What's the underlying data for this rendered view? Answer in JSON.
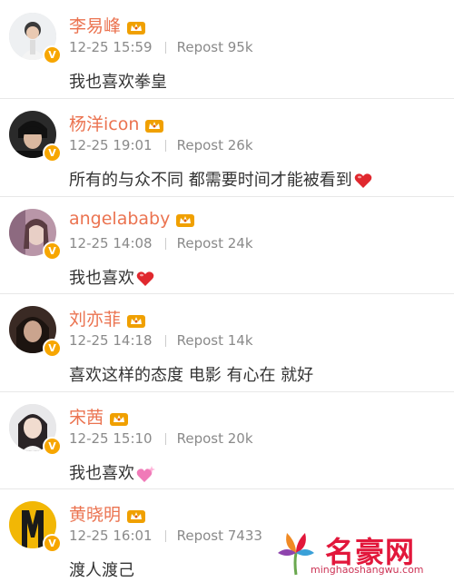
{
  "posts": [
    {
      "name": "李易峰",
      "date": "12-25 15:59",
      "repost": "Repost 95k",
      "text": "我也喜欢拳皇",
      "emoji": "none"
    },
    {
      "name": "杨洋icon",
      "date": "12-25 19:01",
      "repost": "Repost 26k",
      "text": "所有的与众不同 都需要时间才能被看到",
      "emoji": "red-heart"
    },
    {
      "name": "angelababy",
      "date": "12-25 14:08",
      "repost": "Repost 24k",
      "text": "我也喜欢",
      "emoji": "red-heart"
    },
    {
      "name": "刘亦菲",
      "date": "12-25 14:18",
      "repost": "Repost 14k",
      "text": "喜欢这样的态度 电影 有心在 就好",
      "emoji": "none"
    },
    {
      "name": "宋茜",
      "date": "12-25 15:10",
      "repost": "Repost 20k",
      "text": "我也喜欢",
      "emoji": "pink-sparkle-heart"
    },
    {
      "name": "黄晓明",
      "date": "12-25 16:01",
      "repost": "Repost 7433",
      "text": "渡人渡己",
      "emoji": "none"
    }
  ],
  "verified_badge": "V",
  "colors": {
    "name": "#eb7350",
    "meta": "#8a8a8a",
    "badge": "#f7a600",
    "watermark": "#e2173b"
  },
  "watermark": {
    "title": "名豪网",
    "url": "minghaoshangwu.com"
  }
}
